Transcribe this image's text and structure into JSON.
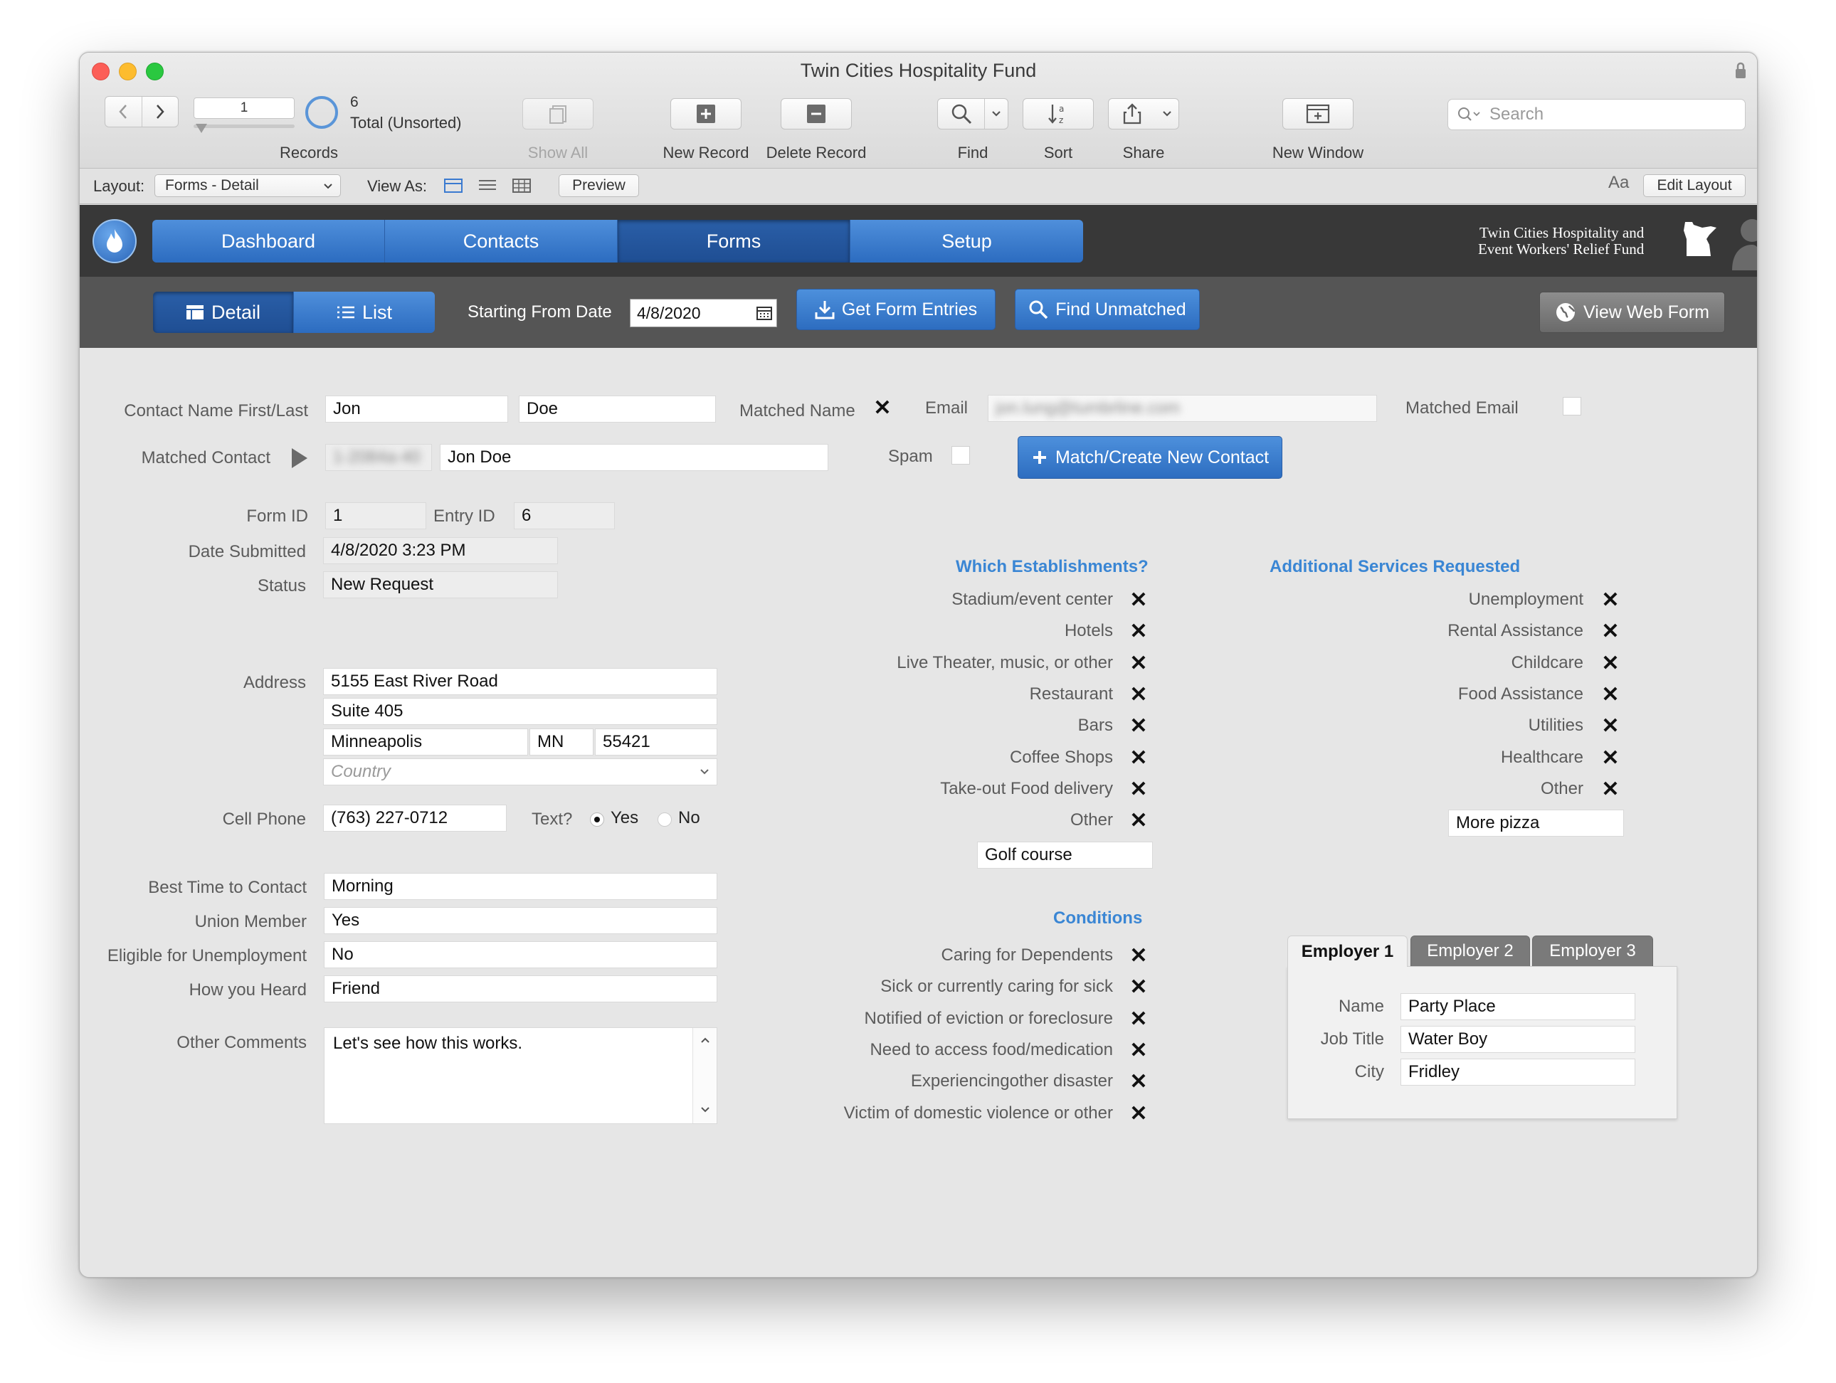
{
  "window": {
    "title": "Twin Cities Hospitality Fund"
  },
  "toolbar": {
    "record_value": "1",
    "record_total": "6",
    "record_total_label": "Total (Unsorted)",
    "records_label": "Records",
    "show_all": "Show All",
    "new_record": "New Record",
    "delete_record": "Delete Record",
    "find": "Find",
    "sort": "Sort",
    "share": "Share",
    "new_window": "New Window",
    "search_placeholder": "Search"
  },
  "layoutbar": {
    "layout_label": "Layout:",
    "layout_value": "Forms - Detail",
    "view_as_label": "View As:",
    "preview": "Preview",
    "edit_layout": "Edit Layout",
    "font_icon_text": "Aa"
  },
  "nav": {
    "tabs": [
      {
        "label": "Dashboard"
      },
      {
        "label": "Contacts"
      },
      {
        "label": "Forms"
      },
      {
        "label": "Setup"
      }
    ],
    "active_tab": "Forms",
    "logo_line1": "Twin Cities Hospitality and",
    "logo_line2": "Event Workers' Relief Fund"
  },
  "subnav": {
    "detail": "Detail",
    "list": "List",
    "starting_from_date_label": "Starting From Date",
    "starting_from_date": "4/8/2020",
    "get_form_entries": "Get Form Entries",
    "find_unmatched": "Find Unmatched",
    "view_web_form": "View Web Form"
  },
  "form": {
    "contact_name_label": "Contact Name First/Last",
    "first_name": "Jon",
    "last_name": "Doe",
    "matched_name_label": "Matched Name",
    "email_label": "Email",
    "email_value": "jon.lung@tumbrline.com",
    "matched_email_label": "Matched Email",
    "matched_contact_label": "Matched Contact",
    "matched_contact_id": "1-2084a-40",
    "matched_contact_name": "Jon Doe",
    "spam_label": "Spam",
    "match_create_button": "Match/Create New Contact",
    "form_id_label": "Form ID",
    "form_id": "1",
    "entry_id_label": "Entry ID",
    "entry_id": "6",
    "date_submitted_label": "Date Submitted",
    "date_submitted": "4/8/2020 3:23 PM",
    "status_label": "Status",
    "status": "New Request",
    "address_label": "Address",
    "address1": "5155 East River Road",
    "address2": "Suite 405",
    "city": "Minneapolis",
    "state": "MN",
    "zip": "55421",
    "country_placeholder": "Country",
    "cell_phone_label": "Cell Phone",
    "cell_phone": "(763) 227-0712",
    "text_label": "Text?",
    "text_yes": "Yes",
    "text_no": "No",
    "best_time_label": "Best Time to Contact",
    "best_time": "Morning",
    "union_member_label": "Union Member",
    "union_member": "Yes",
    "eligible_label": "Eligible for Unemployment",
    "eligible": "No",
    "how_heard_label": "How you Heard",
    "how_heard": "Friend",
    "other_comments_label": "Other Comments",
    "other_comments": "Let's see how this works."
  },
  "establishments": {
    "title": "Which Establishments?",
    "items": [
      "Stadium/event center",
      "Hotels",
      "Live Theater, music, or other",
      "Restaurant",
      "Bars",
      "Coffee Shops",
      "Take-out Food delivery",
      "Other"
    ],
    "other_value": "Golf course"
  },
  "services": {
    "title": "Additional Services Requested",
    "items": [
      "Unemployment",
      "Rental Assistance",
      "Childcare",
      "Food Assistance",
      "Utilities",
      "Healthcare",
      "Other"
    ],
    "other_value": "More pizza"
  },
  "conditions": {
    "title": "Conditions",
    "items": [
      "Caring for Dependents",
      "Sick or currently caring for sick",
      "Notified of eviction or foreclosure",
      "Need to access food/medication",
      "Experiencingother disaster",
      "Victim of domestic violence or other"
    ]
  },
  "employer": {
    "tabs": [
      "Employer 1",
      "Employer 2",
      "Employer 3"
    ],
    "name_label": "Name",
    "name": "Party Place",
    "job_title_label": "Job Title",
    "job_title": "Water Boy",
    "city_label": "City",
    "city": "Fridley"
  },
  "colors": {
    "accent": "#2f6fc4",
    "nav_bg": "#383838",
    "subnav_bg": "#555555",
    "section_title": "#3a86d4"
  }
}
